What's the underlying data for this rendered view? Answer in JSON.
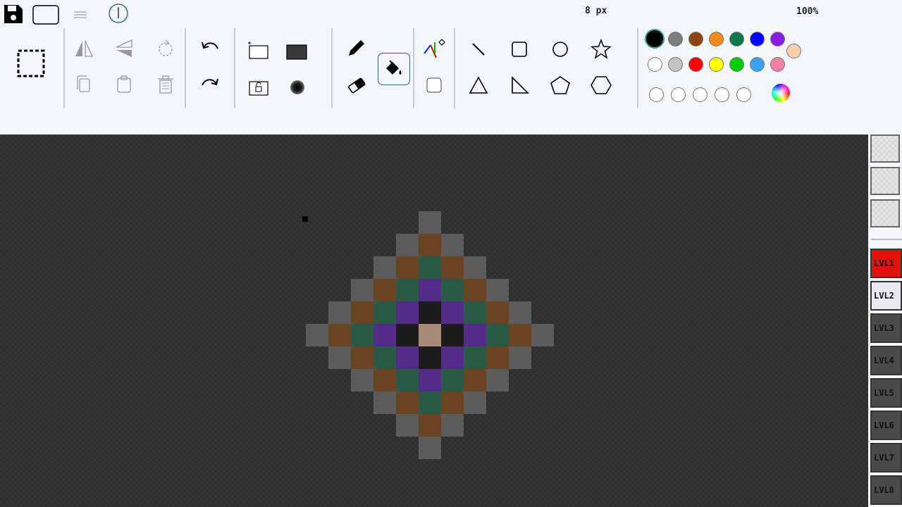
{
  "status": {
    "brush_size": "8 px",
    "zoom": "100%"
  },
  "top_icons": [
    "save-icon",
    "rounded-rect-icon",
    "menu-icon",
    "info-icon"
  ],
  "toolbar": {
    "selection": [
      "select-icon"
    ],
    "clipboard": [
      "flip-horizontal-icon",
      "flip-vertical-icon",
      "rotate-icon",
      "copy-icon",
      "paste-icon",
      "trash-icon"
    ],
    "history": [
      "undo-icon",
      "redo-icon"
    ],
    "canvas": [
      "new-canvas-icon",
      "fill-canvas-icon",
      "lock-canvas-icon",
      "soft-brush-icon"
    ],
    "draw": [
      "pencil-icon",
      "paint-bucket-icon",
      "eraser-icon"
    ],
    "misc": [
      "color-picker-icon",
      "empty-square-icon"
    ],
    "shapes": [
      "line-icon",
      "square-icon",
      "circle-icon",
      "star-icon",
      "triangle-icon",
      "right-triangle-icon",
      "pentagon-icon",
      "hexagon-icon"
    ]
  },
  "palette": {
    "row1": [
      "#000000",
      "#7f7f7f",
      "#8b4513",
      "#f28b1f",
      "#0a7a4a",
      "#0000ff",
      "#8a1ee0"
    ],
    "row2": [
      "#ffffff",
      "#c3c3c3",
      "#ff0000",
      "#ffff00",
      "#00cc00",
      "#3aa0f0",
      "#f080a0"
    ],
    "row3": [
      "#ffffff",
      "#ffffff",
      "#ffffff",
      "#ffffff",
      "#ffffff"
    ],
    "extra": "#f8cfa8",
    "selected": "#000000"
  },
  "pixel_art": {
    "colors": {
      "G": "#5c5c5c",
      "B": "#6b4424",
      "T": "#2b5a47",
      "P": "#552b8a",
      "K": "#1c1c1c",
      "C": "#a88a78"
    },
    "rows": [
      "     G     ",
      "    GBG    ",
      "   GBTBG   ",
      "  GBTPTBG  ",
      " GBTPKPTBG ",
      "GBTPKCKPTBG",
      " GBTPKPTBG ",
      "  GBTPTBG  ",
      "   GBTBG   ",
      "    GBG    ",
      "     G     "
    ]
  },
  "layers": [
    {
      "label": "LVL1",
      "state": "active"
    },
    {
      "label": "LVL2",
      "state": "light"
    },
    {
      "label": "LVL3",
      "state": ""
    },
    {
      "label": "LVL4",
      "state": ""
    },
    {
      "label": "LVL5",
      "state": ""
    },
    {
      "label": "LVL6",
      "state": ""
    },
    {
      "label": "LVL7",
      "state": ""
    },
    {
      "label": "LVL8",
      "state": ""
    }
  ]
}
